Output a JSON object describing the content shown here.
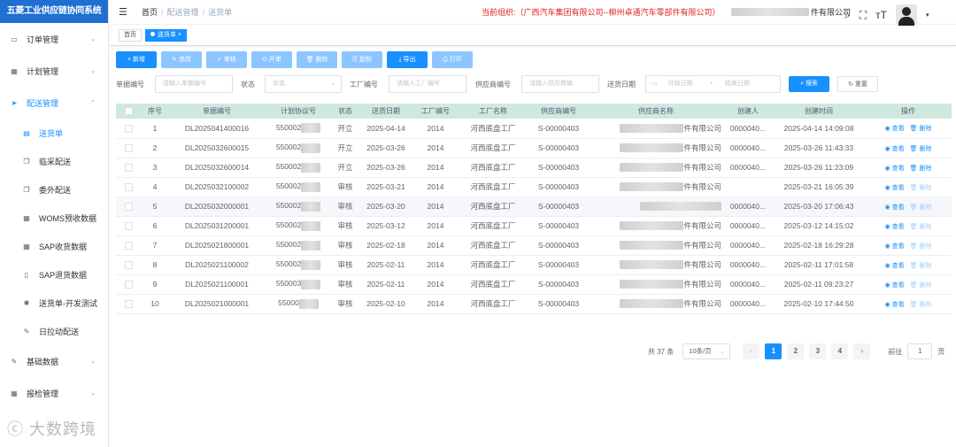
{
  "app": {
    "title": "五菱工业供应链协同系统"
  },
  "sidebar": {
    "items": [
      {
        "label": "订单管理",
        "icon": "order-icon",
        "expanded": false
      },
      {
        "label": "计划管理",
        "icon": "plan-icon",
        "expanded": false
      },
      {
        "label": "配送管理",
        "icon": "send-icon",
        "expanded": true
      },
      {
        "label": "基础数据",
        "icon": "data-icon",
        "expanded": false
      },
      {
        "label": "报检管理",
        "icon": "inspect-icon",
        "expanded": false
      }
    ],
    "sub_items": [
      {
        "label": "送货单",
        "icon": "doc-icon",
        "selected": true
      },
      {
        "label": "临采配送",
        "icon": "copy-icon"
      },
      {
        "label": "委外配送",
        "icon": "copy-icon"
      },
      {
        "label": "WOMS预收数据",
        "icon": "grid-icon"
      },
      {
        "label": "SAP收货数据",
        "icon": "grid-icon"
      },
      {
        "label": "SAP退货数据",
        "icon": "book-icon"
      },
      {
        "label": "送货单-开发测试",
        "icon": "bug-icon"
      },
      {
        "label": "日拉动配送",
        "icon": "edit-icon"
      }
    ],
    "expand_arrow": "⌄",
    "collapse_arrow": "⌃"
  },
  "header": {
    "breadcrumb": [
      "首页",
      "配送管理",
      "送货单"
    ],
    "breadcrumb_sep": "/",
    "org_text": "当前组织:（广西汽车集团有限公司--柳州卓通汽车零部件有限公司）",
    "company_suffix": "件有限公司"
  },
  "tags": {
    "home": "首页",
    "current": "送货单",
    "close": "×"
  },
  "toolbar": {
    "add": "+ 新增",
    "edit": "✎ 修改",
    "audit": "✓ 审核",
    "open": "⊙ 开审",
    "delete": "🗑 删除",
    "copy": "⎘ 复制",
    "export": "⤓ 导出",
    "print": "⎙ 打印"
  },
  "filters": {
    "doc_no_label": "单据编号",
    "doc_no_placeholder": "请输入单据编号",
    "status_label": "状态",
    "status_placeholder": "状态",
    "plant_label": "工厂编号",
    "plant_placeholder": "请输入工厂编号",
    "supplier_label": "供应商编号",
    "supplier_placeholder": "请输入供应商编",
    "date_label": "送货日期",
    "date_start": "开始日期",
    "date_sep": "-",
    "date_end": "结束日期",
    "search": "搜索",
    "reset": "重置"
  },
  "table": {
    "columns": [
      "序号",
      "单据编号",
      "计划协议号",
      "状态",
      "送货日期",
      "工厂编号",
      "工厂名称",
      "供应商编号",
      "供应商名称",
      "创建人",
      "创建时间",
      "操作"
    ],
    "op_view": "查看",
    "op_delete": "删除",
    "rows": [
      {
        "no": "1",
        "doc": "DL2025041400016",
        "plan": "550002",
        "status": "开立",
        "date": "2025-04-14",
        "plant": "2014",
        "plant_name": "河西底盘工厂",
        "sup_no": "S-00000403",
        "sup_name": "件有限公司",
        "creator": "0000040...",
        "created": "2025-04-14 14:09:08",
        "del_enabled": true
      },
      {
        "no": "2",
        "doc": "DL2025032600015",
        "plan": "550002",
        "status": "开立",
        "date": "2025-03-26",
        "plant": "2014",
        "plant_name": "河西底盘工厂",
        "sup_no": "S-00000403",
        "sup_name": "件有限公司",
        "creator": "0000040...",
        "created": "2025-03-26 11:43:33",
        "del_enabled": true
      },
      {
        "no": "3",
        "doc": "DL2025032600014",
        "plan": "550002",
        "status": "开立",
        "date": "2025-03-26",
        "plant": "2014",
        "plant_name": "河西底盘工厂",
        "sup_no": "S-00000403",
        "sup_name": "件有限公司",
        "creator": "0000040...",
        "created": "2025-03-26 11:23:09",
        "del_enabled": true
      },
      {
        "no": "4",
        "doc": "DL2025032100002",
        "plan": "550002",
        "status": "审核",
        "date": "2025-03-21",
        "plant": "2014",
        "plant_name": "河西底盘工厂",
        "sup_no": "S-00000403",
        "sup_name": "件有限公司",
        "creator": "",
        "created": "2025-03-21 16:05:39",
        "del_enabled": false
      },
      {
        "no": "5",
        "doc": "DL2025032000001",
        "plan": "550002",
        "status": "审核",
        "date": "2025-03-20",
        "plant": "2014",
        "plant_name": "河西底盘工厂",
        "sup_no": "S-00000403",
        "sup_name": "",
        "creator": "0000040...",
        "created": "2025-03-20 17:06:43",
        "del_enabled": false
      },
      {
        "no": "6",
        "doc": "DL2025031200001",
        "plan": "550002",
        "status": "审核",
        "date": "2025-03-12",
        "plant": "2014",
        "plant_name": "河西底盘工厂",
        "sup_no": "S-00000403",
        "sup_name": "件有限公司",
        "creator": "0000040...",
        "created": "2025-03-12 14:15:02",
        "del_enabled": false
      },
      {
        "no": "7",
        "doc": "DL2025021800001",
        "plan": "550002",
        "status": "审核",
        "date": "2025-02-18",
        "plant": "2014",
        "plant_name": "河西底盘工厂",
        "sup_no": "S-00000403",
        "sup_name": "件有限公司",
        "creator": "0000040...",
        "created": "2025-02-18 16:29:28",
        "del_enabled": false
      },
      {
        "no": "8",
        "doc": "DL2025021100002",
        "plan": "550002",
        "status": "审核",
        "date": "2025-02-11",
        "plant": "2014",
        "plant_name": "河西底盘工厂",
        "sup_no": "S-00000403",
        "sup_name": "件有限公司",
        "creator": "0000040...",
        "created": "2025-02-11 17:01:58",
        "del_enabled": false
      },
      {
        "no": "9",
        "doc": "DL2025021100001",
        "plan": "550003",
        "status": "审核",
        "date": "2025-02-11",
        "plant": "2014",
        "plant_name": "河西底盘工厂",
        "sup_no": "S-00000403",
        "sup_name": "件有限公司",
        "creator": "0000040...",
        "created": "2025-02-11 09:23:27",
        "del_enabled": false
      },
      {
        "no": "10",
        "doc": "DL2025021000001",
        "plan": "55000",
        "status": "审核",
        "date": "2025-02-10",
        "plant": "2014",
        "plant_name": "河西底盘工厂",
        "sup_no": "S-00000403",
        "sup_name": "件有限公司",
        "creator": "0000040...",
        "created": "2025-02-10 17:44:50",
        "del_enabled": false
      }
    ]
  },
  "pager": {
    "total": "共 37 条",
    "size": "10条/页",
    "pages": [
      "1",
      "2",
      "3",
      "4"
    ],
    "current": "1",
    "prev": "‹",
    "next": "›",
    "goto_label": "前往",
    "goto_value": "1",
    "goto_unit": "页"
  },
  "watermark": "大数跨境",
  "colors": {
    "primary": "#1890ff",
    "brand": "#1f6fd1",
    "org": "#e02020",
    "table_header": "#cfe8e0"
  }
}
